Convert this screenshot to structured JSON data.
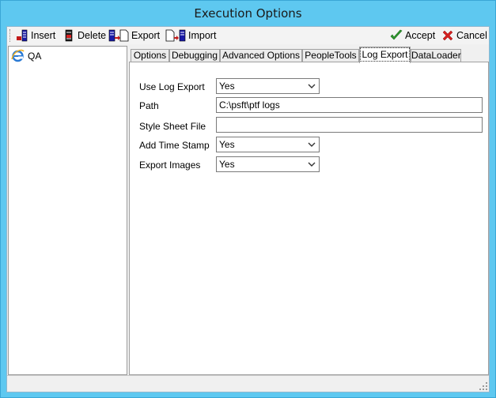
{
  "window": {
    "title": "Execution Options"
  },
  "toolbar": {
    "insert_label": "Insert",
    "delete_label": "Delete",
    "export_label": "Export",
    "import_label": "Import",
    "accept_label": "Accept",
    "cancel_label": "Cancel"
  },
  "tree": {
    "items": [
      {
        "label": "QA",
        "icon": "ie-icon"
      }
    ]
  },
  "tabs": [
    {
      "label": "Options"
    },
    {
      "label": "Debugging"
    },
    {
      "label": "Advanced Options"
    },
    {
      "label": "PeopleTools"
    },
    {
      "label": "Log Export",
      "active": true
    },
    {
      "label": "DataLoader"
    }
  ],
  "form": {
    "use_log_export": {
      "label": "Use Log Export",
      "value": "Yes"
    },
    "path": {
      "label": "Path",
      "value": "C:\\psft\\ptf logs"
    },
    "style_sheet_file": {
      "label": "Style Sheet File",
      "value": ""
    },
    "add_time_stamp": {
      "label": "Add Time Stamp",
      "value": "Yes"
    },
    "export_images": {
      "label": "Export Images",
      "value": "Yes"
    }
  },
  "colors": {
    "title_bar": "#5ec8f0",
    "accept_icon": "#2e9a2e",
    "cancel_icon": "#d42020"
  }
}
